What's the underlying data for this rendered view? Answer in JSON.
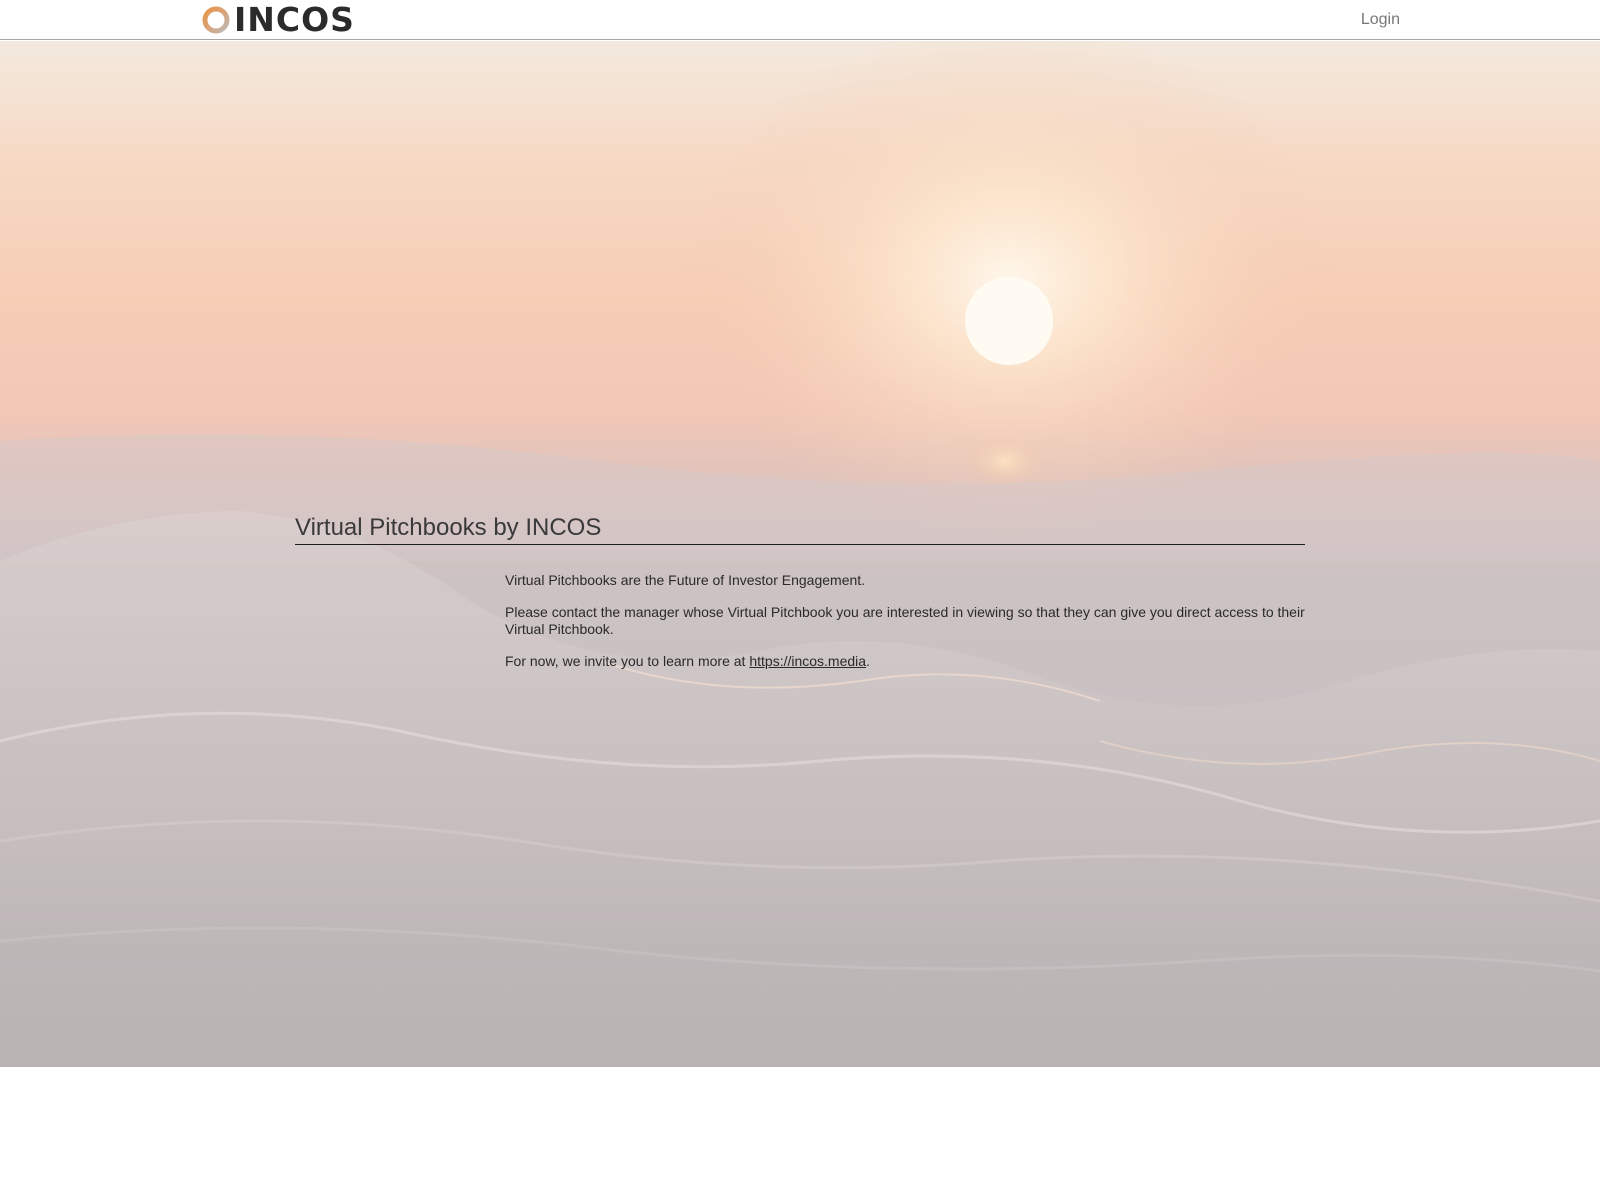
{
  "header": {
    "logo_text": "INCOS",
    "login_label": "Login"
  },
  "main": {
    "title": "Virtual Pitchbooks by INCOS",
    "paragraph_1": "Virtual Pitchbooks are the Future of Investor Engagement.",
    "paragraph_2": "Please contact the manager whose Virtual Pitchbook you are interested in viewing so that they can give you direct access to their Virtual Pitchbook.",
    "paragraph_3_prefix": "For now, we invite you to learn more at ",
    "link_text": "https://incos.media",
    "paragraph_3_suffix": "."
  },
  "colors": {
    "logo_ring_orange": "#e8964a",
    "logo_ring_grey": "#b9b9b9",
    "logo_text": "#2b2b2b",
    "login_text": "#777777"
  }
}
